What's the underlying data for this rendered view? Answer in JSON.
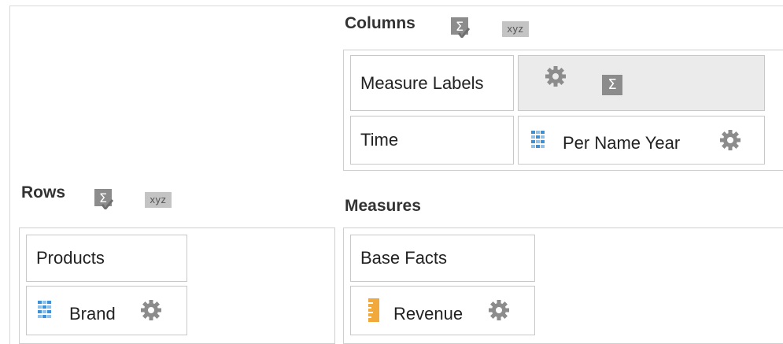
{
  "columns": {
    "title": "Columns",
    "sum_icon": "sigma-check-icon",
    "xyz_label": "xyz",
    "rows": [
      {
        "label": "Measure Labels",
        "value": "",
        "value_icons": [
          "gear-icon",
          "sigma-icon"
        ],
        "sigma_glyph": "Σ"
      },
      {
        "label": "Time",
        "value": "Per Name Year",
        "value_icons": [
          "hierarchy-grid-icon",
          "gear-icon"
        ]
      }
    ]
  },
  "rows": {
    "title": "Rows",
    "sum_icon": "sigma-check-icon",
    "xyz_label": "xyz",
    "dimension": {
      "header": "Products",
      "item": "Brand",
      "item_icons": [
        "hierarchy-grid-icon",
        "gear-icon"
      ]
    }
  },
  "measures": {
    "title": "Measures",
    "group": {
      "header": "Base Facts",
      "item": "Revenue",
      "item_icons": [
        "measure-ruler-icon",
        "gear-icon"
      ]
    }
  },
  "colors": {
    "border": "#c8c8c8",
    "selected_cell_bg": "#ebebeb",
    "icon_gray": "#8c8c8c",
    "grid_blue": "#3d8fd6",
    "ruler_orange": "#f2a93b"
  }
}
